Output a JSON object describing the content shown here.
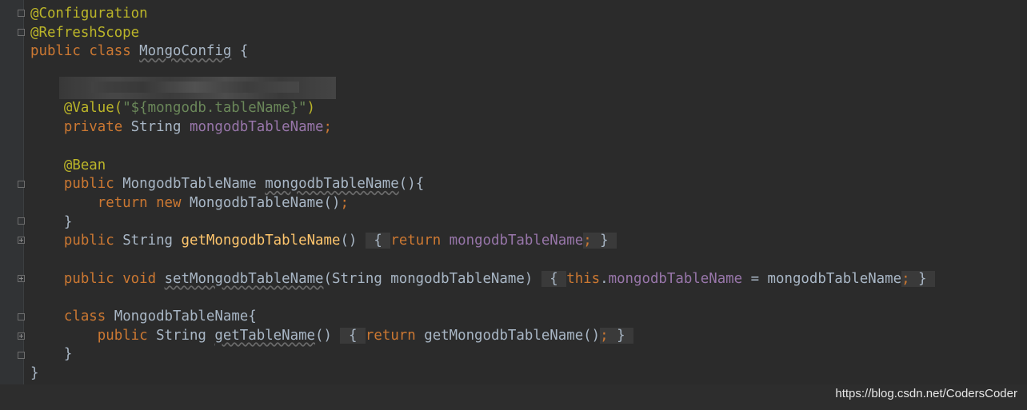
{
  "code": {
    "l1_annotation": "@Configuration",
    "l2_annotation": "@RefreshScope",
    "l3_kw1": "public",
    "l3_kw2": "class",
    "l3_name": "MongoConfig",
    "l3_brace": "{",
    "l5_annotation": "@Value(",
    "l5_string": "\"${mongodb.tableName}\"",
    "l5_close": ")",
    "l6_kw": "private",
    "l6_type": "String",
    "l6_field": "mongodbTableName",
    "l6_semi": ";",
    "l8_annotation": "@Bean",
    "l9_kw": "public",
    "l9_type": "MongodbTableName",
    "l9_method": "mongodbTableName",
    "l9_rest": "(){",
    "l10_kw1": "return",
    "l10_kw2": "new",
    "l10_rest": "MongodbTableName()",
    "l10_semi": ";",
    "l11_brace": "}",
    "l12_kw": "public",
    "l12_type": "String",
    "l12_method": "getMongodbTableName",
    "l12_paren": "()",
    "l12_fold_open": "{",
    "l12_return": "return",
    "l12_field": "mongodbTableName",
    "l12_semi": ";",
    "l12_fold_close": "}",
    "l14_kw1": "public",
    "l14_kw2": "void",
    "l14_method": "setMongodbTableName",
    "l14_params": "(String mongodbTableName)",
    "l14_fold_open": "{",
    "l14_this": "this",
    "l14_dot": ".",
    "l14_field": "mongodbTableName",
    "l14_assign": "= mongodbTableName",
    "l14_semi": ";",
    "l14_fold_close": "}",
    "l16_kw": "class",
    "l16_name": "MongodbTableName{",
    "l17_kw": "public",
    "l17_type": "String",
    "l17_method": "getTableName",
    "l17_paren": "()",
    "l17_fold_open": "{",
    "l17_return": "return",
    "l17_call": "getMongodbTableName()",
    "l17_semi": ";",
    "l17_fold_close": "}",
    "l18_brace": "}",
    "l19_brace": "}"
  },
  "watermark": "https://blog.csdn.net/CodersCoder",
  "colors": {
    "background": "#2b2b2b",
    "keyword": "#cc7832",
    "annotation": "#bbb529",
    "string": "#6a8759",
    "field": "#9876aa",
    "method": "#ffc66d",
    "text": "#a9b7c6"
  }
}
